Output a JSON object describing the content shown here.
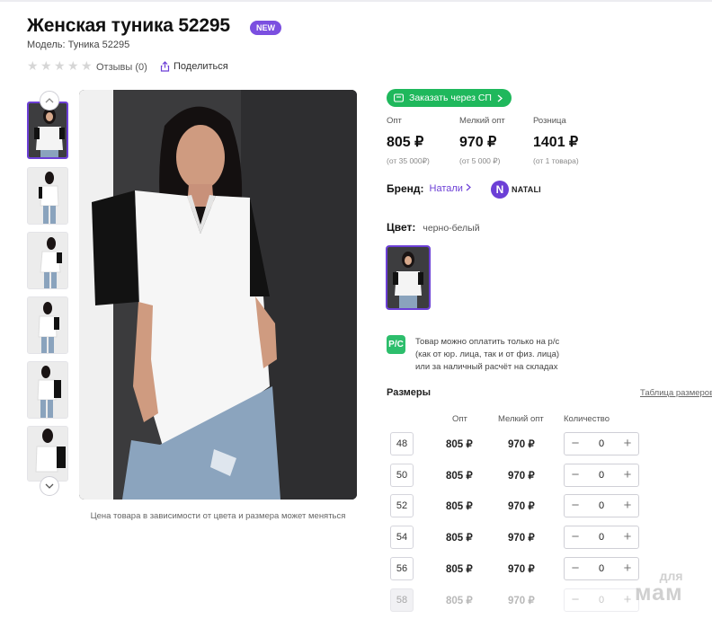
{
  "product": {
    "title": "Женская туника 52295",
    "badge": "NEW",
    "model": "Модель: Туника 52295",
    "reviews": "Отзывы (0)",
    "share": "Поделиться"
  },
  "gallery": {
    "caption": "Цена товара в зависимости от цвета и размера может меняться"
  },
  "order": {
    "label": "Заказать через СП"
  },
  "prices": [
    {
      "label": "Опт",
      "value": "805 ₽",
      "note": "(от 35 000₽)"
    },
    {
      "label": "Мелкий опт",
      "value": "970 ₽",
      "note": "(от 5 000 ₽)"
    },
    {
      "label": "Розница",
      "value": "1401 ₽",
      "note": "(от 1 товара)"
    }
  ],
  "brand": {
    "key": "Бренд:",
    "name": "Натали",
    "logo_letter": "N",
    "logo_text": "NATALI"
  },
  "color": {
    "key": "Цвет:",
    "value": "черно-белый"
  },
  "payment": {
    "icon": "Р/С",
    "lines": [
      "Товар можно оплатить только на р/с",
      "(как от юр. лица, так и от физ. лица)",
      "или за наличный расчёт на складах"
    ]
  },
  "sizes": {
    "title": "Размеры",
    "table_link": "Таблица размеров",
    "headers": {
      "opt": "Опт",
      "small_opt": "Мелкий опт",
      "qty": "Количество"
    },
    "rows": [
      {
        "size": "48",
        "opt": "805 ₽",
        "small_opt": "970 ₽",
        "qty": "0"
      },
      {
        "size": "50",
        "opt": "805 ₽",
        "small_opt": "970 ₽",
        "qty": "0"
      },
      {
        "size": "52",
        "opt": "805 ₽",
        "small_opt": "970 ₽",
        "qty": "0"
      },
      {
        "size": "54",
        "opt": "805 ₽",
        "small_opt": "970 ₽",
        "qty": "0"
      },
      {
        "size": "56",
        "opt": "805 ₽",
        "small_opt": "970 ₽",
        "qty": "0"
      },
      {
        "size": "58",
        "opt": "805 ₽",
        "small_opt": "970 ₽",
        "qty": "0"
      }
    ]
  },
  "watermark": {
    "small": "для",
    "big": "мам"
  },
  "colors": {
    "accent": "#6c3fd6",
    "green": "#1fb85c",
    "badge": "#7b4fe0"
  }
}
